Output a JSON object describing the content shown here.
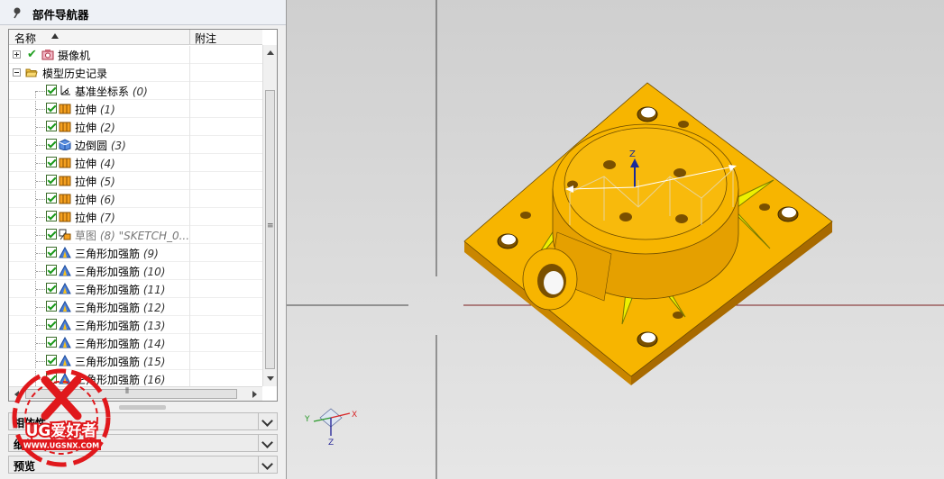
{
  "navigator": {
    "title": "部件导航器",
    "columns": {
      "name": "名称",
      "notes": "附注"
    },
    "items": [
      {
        "label": "摄像机",
        "num": "",
        "icon": "camera-icon"
      },
      {
        "label": "模型历史记录",
        "num": "",
        "icon": "folder-open-icon"
      },
      {
        "label": "基准坐标系",
        "num": "(0)",
        "icon": "datum-csys-icon"
      },
      {
        "label": "拉伸",
        "num": "(1)",
        "icon": "extrude-icon"
      },
      {
        "label": "拉伸",
        "num": "(2)",
        "icon": "extrude-icon"
      },
      {
        "label": "边倒圆",
        "num": "(3)",
        "icon": "edge-blend-icon"
      },
      {
        "label": "拉伸",
        "num": "(4)",
        "icon": "extrude-icon"
      },
      {
        "label": "拉伸",
        "num": "(5)",
        "icon": "extrude-icon"
      },
      {
        "label": "拉伸",
        "num": "(6)",
        "icon": "extrude-icon"
      },
      {
        "label": "拉伸",
        "num": "(7)",
        "icon": "extrude-icon"
      },
      {
        "label": "草图",
        "num": "(8) \"SKETCH_0...",
        "icon": "sketch-icon"
      },
      {
        "label": "三角形加强筋",
        "num": "(9)",
        "icon": "rib-icon"
      },
      {
        "label": "三角形加强筋",
        "num": "(10)",
        "icon": "rib-icon"
      },
      {
        "label": "三角形加强筋",
        "num": "(11)",
        "icon": "rib-icon"
      },
      {
        "label": "三角形加强筋",
        "num": "(12)",
        "icon": "rib-icon"
      },
      {
        "label": "三角形加强筋",
        "num": "(13)",
        "icon": "rib-icon"
      },
      {
        "label": "三角形加强筋",
        "num": "(14)",
        "icon": "rib-icon"
      },
      {
        "label": "三角形加强筋",
        "num": "(15)",
        "icon": "rib-icon"
      },
      {
        "label": "三角形加强筋",
        "num": "(16)",
        "icon": "rib-icon"
      }
    ],
    "sections": [
      {
        "label": "相依性"
      },
      {
        "label": "细节"
      },
      {
        "label": "预览"
      }
    ]
  },
  "watermark": {
    "brand": "UG爱好者",
    "url": "WWW.UGSNX.COM"
  },
  "viewport": {
    "triad": {
      "x_label": "X",
      "y_label": "Y",
      "z_label": "Z"
    },
    "csys": {
      "z_label": "Z"
    }
  },
  "colors": {
    "part_body": "#f7b500",
    "rib": "#eef000",
    "viewport_bg": "#dcdcdc",
    "check_green": "#1a9a1a"
  }
}
